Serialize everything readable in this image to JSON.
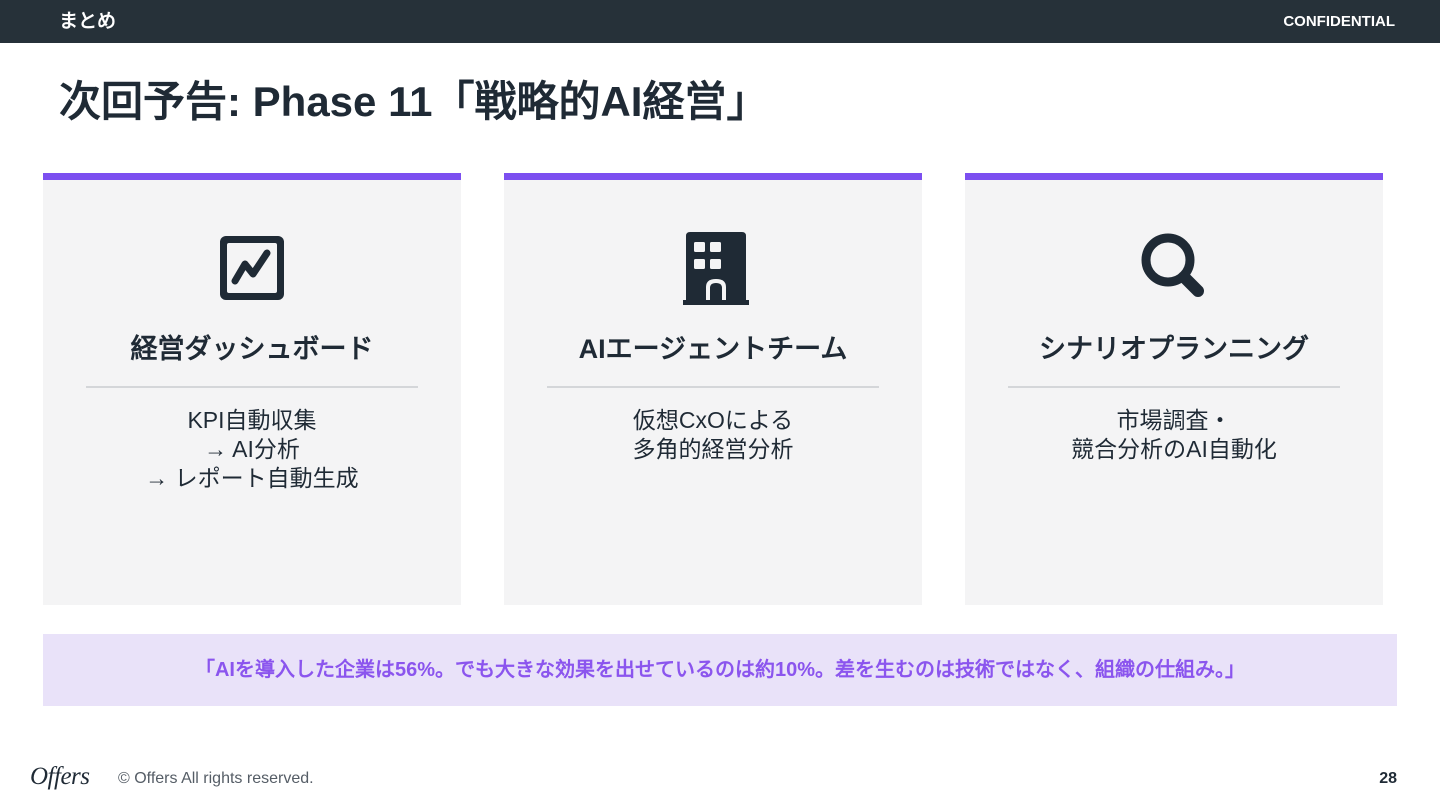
{
  "header": {
    "section": "まとめ",
    "confidentiality": "CONFIDENTIAL"
  },
  "title": "次回予告: Phase 11「戦略的AI経営」",
  "colors": {
    "accent": "#7c4ff0",
    "header_bg": "#263139",
    "card_bg": "#f4f4f5",
    "quote_bg": "#e9e2f9",
    "quote_text": "#8b55ee",
    "icon": "#1f2a35"
  },
  "cards": [
    {
      "icon": "chart-line-icon",
      "title": "経営ダッシュボード",
      "lines": [
        "KPI自動収集",
        "→ AI分析",
        "→ レポート自動生成"
      ]
    },
    {
      "icon": "building-icon",
      "title": "AIエージェントチーム",
      "lines": [
        "仮想CxOによる",
        "多角的経営分析"
      ]
    },
    {
      "icon": "search-icon",
      "title": "シナリオプランニング",
      "lines": [
        "市場調査・",
        "競合分析のAI自動化"
      ]
    }
  ],
  "quote": "「AIを導入した企業は56%。でも大きな効果を出せているのは約10%。差を生むのは技術ではなく、組織の仕組み。」",
  "footer": {
    "logo": "Offers",
    "copyright": "© Offers All rights reserved.",
    "page_number": "28"
  }
}
